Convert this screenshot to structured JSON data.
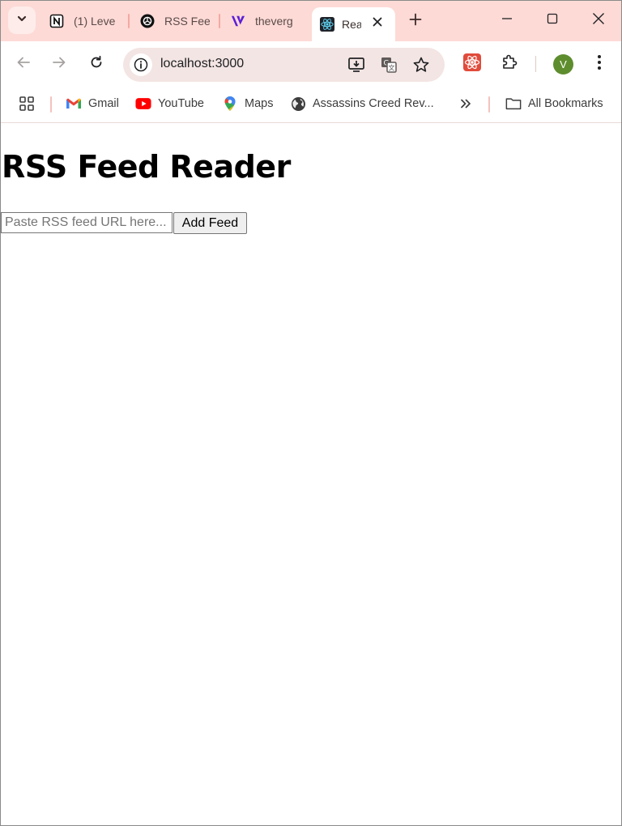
{
  "tabs": [
    {
      "title": "(1) Leve",
      "icon": "notion-icon"
    },
    {
      "title": "RSS Fee",
      "icon": "openai-icon"
    },
    {
      "title": "theverg",
      "icon": "verge-icon"
    },
    {
      "title": "Rea",
      "icon": "react-icon",
      "active": true
    }
  ],
  "address_bar": {
    "url": "localhost:3000"
  },
  "profile": {
    "initial": "V",
    "color": "#5e8d2e"
  },
  "bookmarks": {
    "items": [
      {
        "label": "Gmail",
        "icon": "gmail-icon"
      },
      {
        "label": "YouTube",
        "icon": "youtube-icon"
      },
      {
        "label": "Maps",
        "icon": "maps-icon"
      },
      {
        "label": "Assassins Creed Rev...",
        "icon": "globe-icon"
      }
    ],
    "all_bookmarks": "All Bookmarks"
  },
  "page": {
    "title": "RSS Feed Reader",
    "input_placeholder": "Paste RSS feed URL here...",
    "input_value": "",
    "add_button": "Add Feed"
  },
  "colors": {
    "tabstrip_bg": "#fddad6",
    "omnibox_bg": "#f3e5e3",
    "accent": "#f4a9a2"
  }
}
